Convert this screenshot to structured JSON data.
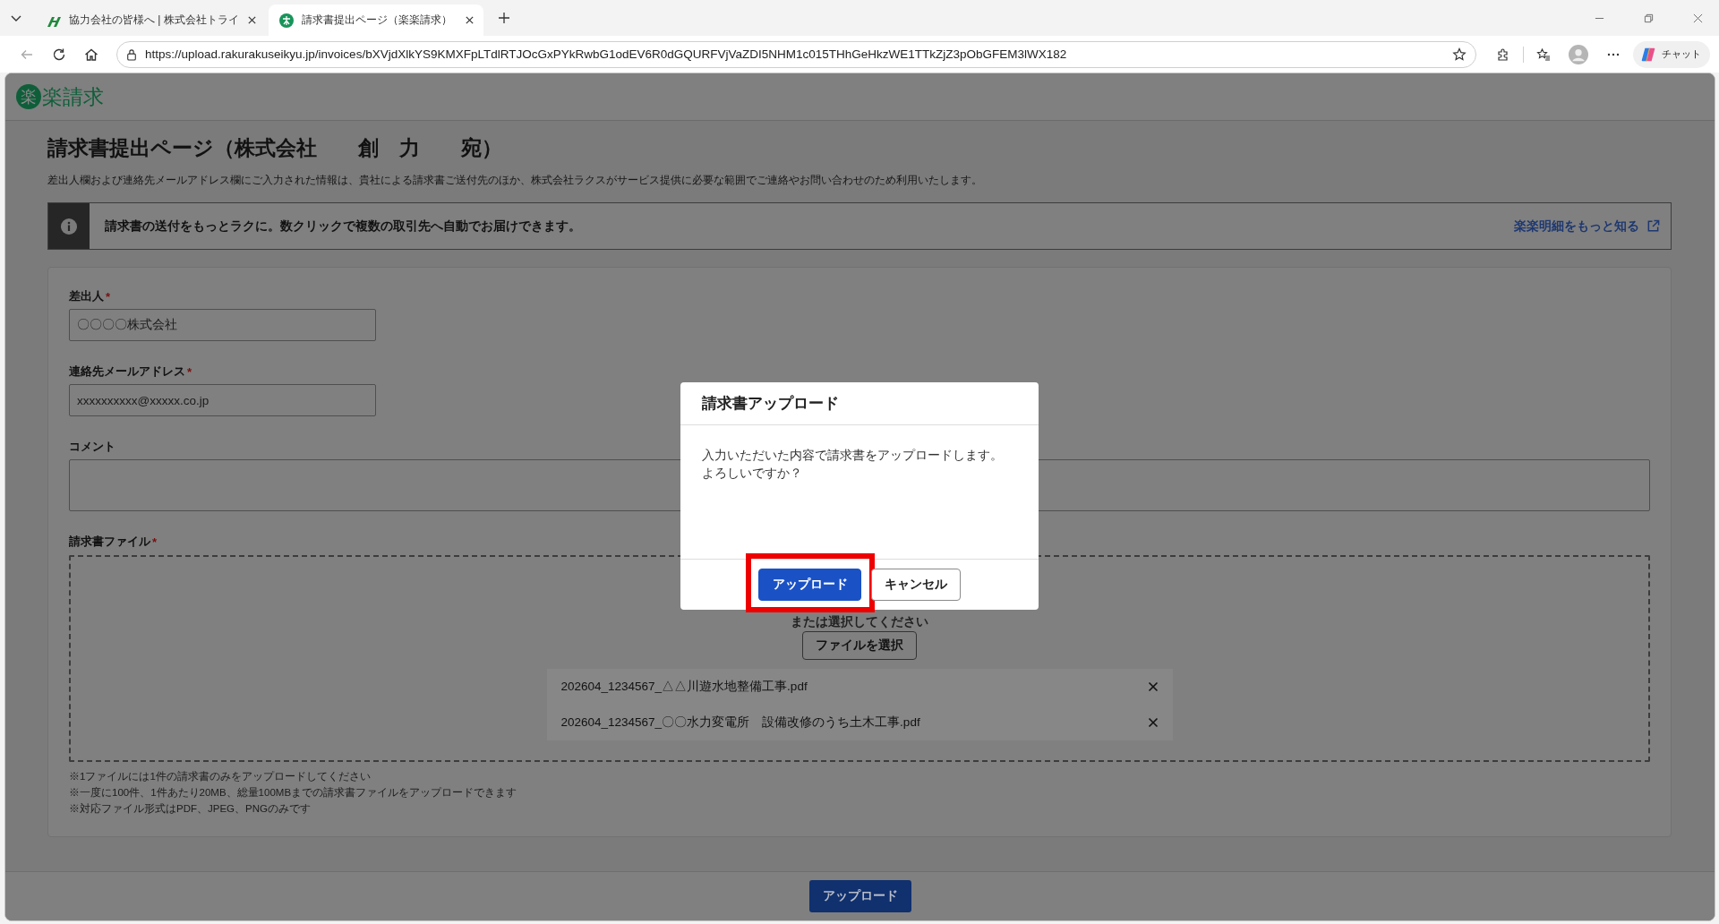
{
  "browser": {
    "tabs": [
      {
        "title": "協力会社の皆様へ | 株式会社トライ",
        "selected": false,
        "kind": "leaf"
      },
      {
        "title": "請求書提出ページ（楽楽請求）",
        "selected": true,
        "kind": "circle"
      }
    ],
    "url": "https://upload.rakurakuseikyu.jp/invoices/bXVjdXlkYS9KMXFpLTdlRTJOcGxPYkRwbG1odEV6R0dGQURFVjVaZDI5NHM1c015THhGeHkzWE1TTkZjZ3pObGFEM3lWX182",
    "chat_label": "チャット"
  },
  "header": {
    "logo_mark": "楽",
    "logo_text": "楽請求"
  },
  "page": {
    "title": "請求書提出ページ（株式会社　　創　力　　宛）",
    "notice": "差出人欄および連絡先メールアドレス欄にご入力された情報は、貴社による請求書ご送付先のほか、株式会社ラクスがサービス提供に必要な範囲でご連絡やお問い合わせのため利用いたします。"
  },
  "banner": {
    "text": "請求書の送付をもっとラクに。数クリックで複数の取引先へ自動でお届けできます。",
    "link": "楽楽明細をもっと知る"
  },
  "form": {
    "fields": [
      {
        "kind": "input",
        "label": "差出人",
        "required_mark": "*",
        "value": "〇〇〇〇株式会社"
      },
      {
        "kind": "input",
        "label": "連絡先メールアドレス",
        "required_mark": "*",
        "value": "xxxxxxxxxx@xxxxx.co.jp"
      },
      {
        "kind": "textarea",
        "label": "コメント"
      }
    ],
    "file_field": {
      "label": "請求書ファイル",
      "required_mark": "*",
      "drop_hint": "または選択してください",
      "select_button": "ファイルを選択",
      "files": [
        "202604_1234567_△△川遊水地整備工事.pdf",
        "202604_1234567_〇〇水力変電所　設備改修のうち土木工事.pdf"
      ]
    },
    "notes": [
      "※1ファイルには1件の請求書のみをアップロードしてください",
      "※一度に100件、1件あたり20MB、総量100MBまでの請求書ファイルをアップロードできます",
      "※対応ファイル形式はPDF、JPEG、PNGのみです"
    ]
  },
  "footer": {
    "submit": "アップロード"
  },
  "dialog": {
    "title": "請求書アップロード",
    "message_lines": [
      "入力いただいた内容で請求書をアップロードします。",
      "よろしいですか？"
    ],
    "buttons": [
      {
        "label": "アップロード",
        "kind": "primary",
        "highlighted": true
      },
      {
        "label": "キャンセル",
        "kind": "secondary",
        "highlighted": false
      }
    ]
  }
}
